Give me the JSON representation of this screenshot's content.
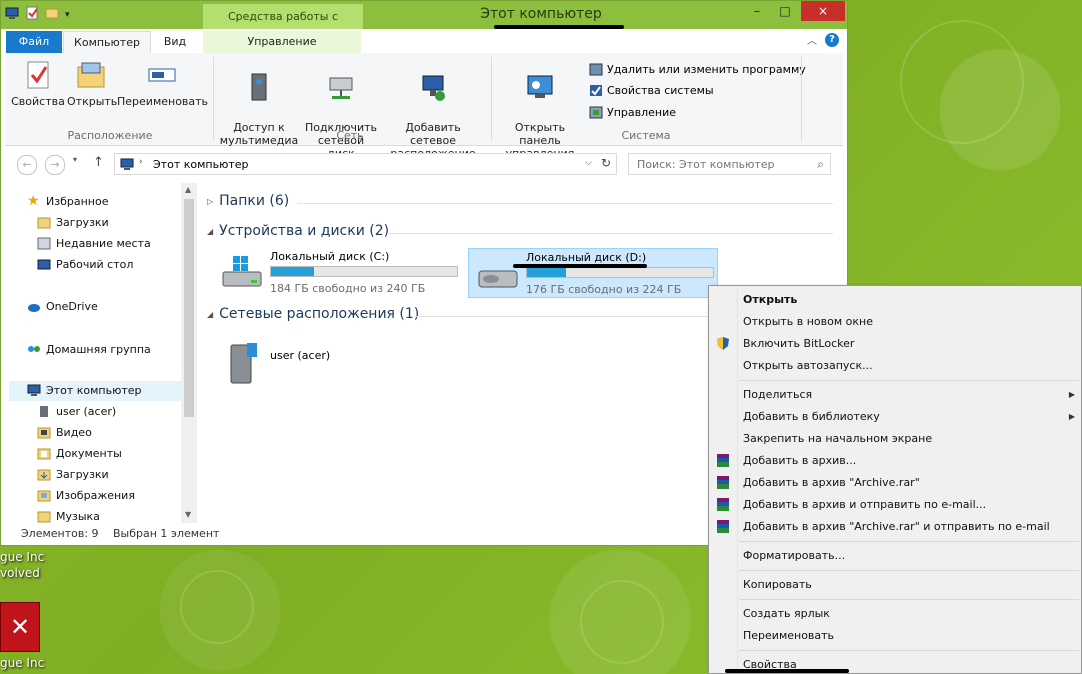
{
  "window": {
    "title": "Этот компьютер",
    "context_tab_title": "Средства работы с дисками",
    "close_icon": "×",
    "minimize_icon": "–",
    "maximize_icon": "□"
  },
  "tabs": {
    "file": "Файл",
    "computer": "Компьютер",
    "view": "Вид",
    "manage": "Управление"
  },
  "ribbon": {
    "location": {
      "label": "Расположение",
      "properties": "Свойства",
      "open": "Открыть",
      "rename": "Переименовать"
    },
    "network": {
      "label": "Сеть",
      "media_access": "Доступ к\nмультимедиа",
      "map_drive": "Подключить\nсетевой диск",
      "add_location": "Добавить сетевое\nрасположение"
    },
    "system": {
      "label": "Система",
      "control_panel": "Открыть панель\nуправления",
      "uninstall": "Удалить или изменить программу",
      "sys_props": "Свойства системы",
      "manage": "Управление"
    }
  },
  "address": {
    "path": "Этот компьютер",
    "search_placeholder": "Поиск: Этот компьютер"
  },
  "nav": {
    "favorites": "Избранное",
    "downloads": "Загрузки",
    "recent": "Недавние места",
    "desktop": "Рабочий стол",
    "onedrive": "OneDrive",
    "homegroup": "Домашняя группа",
    "this_pc": "Этот компьютер",
    "user": "user (acer)",
    "video": "Видео",
    "documents": "Документы",
    "downloads2": "Загрузки",
    "pictures": "Изображения",
    "music": "Музыка"
  },
  "content": {
    "folders_header": "Папки (6)",
    "devices_header": "Устройства и диски (2)",
    "network_header": "Сетевые расположения (1)",
    "drives": [
      {
        "name": "Локальный диск (C:)",
        "free": "184 ГБ свободно из 240 ГБ",
        "used_fraction": 0.23
      },
      {
        "name": "Локальный диск (D:)",
        "free": "176 ГБ свободно из 224 ГБ",
        "used_fraction": 0.21
      }
    ],
    "network_location": "user (acer)"
  },
  "status": {
    "items": "Элементов: 9",
    "selected": "Выбран 1 элемент"
  },
  "desktop": {
    "icon1_line1": "gue Inc",
    "icon1_line2": "volved",
    "icon2_line1": "gue Inc"
  },
  "context_menu": {
    "open": "Открыть",
    "open_new_window": "Открыть в новом окне",
    "bitlocker": "Включить BitLocker",
    "autoplay": "Открыть автозапуск...",
    "share": "Поделиться",
    "add_library": "Добавить в библиотеку",
    "pin_start": "Закрепить на начальном экране",
    "add_archive": "Добавить в архив...",
    "add_archive_rar": "Добавить в архив \"Archive.rar\"",
    "add_archive_email": "Добавить в архив и отправить по e-mail...",
    "add_archive_rar_email": "Добавить в архив \"Archive.rar\" и отправить по e-mail",
    "format": "Форматировать...",
    "copy": "Копировать",
    "create_shortcut": "Создать ярлык",
    "rename": "Переименовать",
    "properties": "Свойства"
  },
  "colors": {
    "accent": "#1979ca",
    "title_green": "#8cbf3e",
    "selection": "#cce8ff",
    "progress": "#26a0da"
  }
}
